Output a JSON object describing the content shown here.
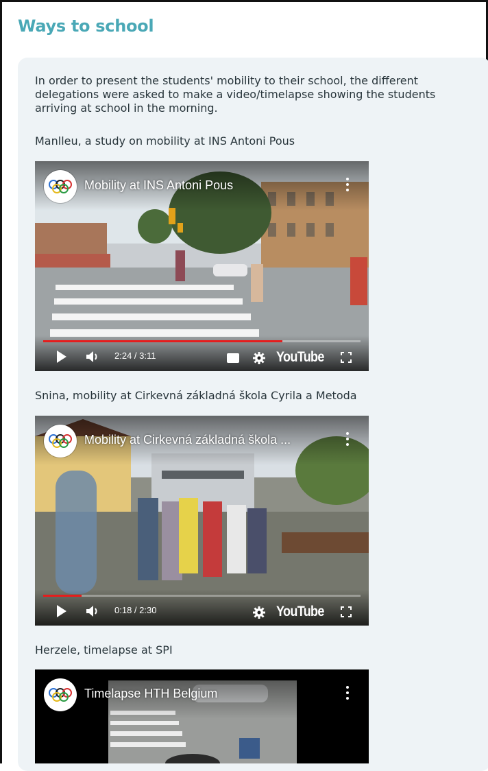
{
  "section": {
    "title": "Ways to school",
    "intro": "In order to present the students' mobility to their school, the different delegations were asked to make a video/timelapse showing the students arriving at school in the morning."
  },
  "videos": [
    {
      "caption": "Manlleu, a study on mobility at INS Antoni Pous",
      "title": "Mobility at INS Antoni Pous",
      "time": "2:24 / 3:11",
      "progress": 0.754,
      "has_cc": true
    },
    {
      "caption": "Snina, mobility at Cirkevná základná škola Cyrila a Metoda",
      "title": "Mobility at Cirkevná základná škola ...",
      "time": "0:18 / 2:30",
      "progress": 0.12,
      "has_cc": false
    },
    {
      "caption": "Herzele, timelapse at SPI",
      "title": "Timelapse HTH Belgium"
    }
  ],
  "player": {
    "brand": "YouTube"
  },
  "colors": {
    "title": "#4aa8b6",
    "panel_bg": "#eef3f6",
    "progress": "#e51d1d"
  },
  "icons": [
    "olympic-rings-icon",
    "menu-dots-icon",
    "play-icon",
    "volume-icon",
    "subtitles-icon",
    "gear-icon",
    "fullscreen-icon"
  ]
}
